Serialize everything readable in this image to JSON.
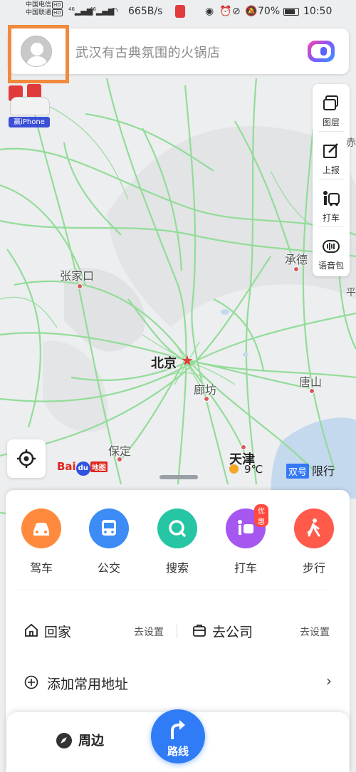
{
  "status_bar": {
    "carrier1": "中国电信",
    "carrier2": "中国联通",
    "hd": "HD",
    "net1": "46",
    "net2": "46",
    "speed": "665B/s",
    "battery": "70%",
    "time": "10:50"
  },
  "search": {
    "placeholder": "武汉有古典氛围的火锅店"
  },
  "promo": {
    "label": "赢iPhone"
  },
  "toolbar": {
    "layers": "图层",
    "report": "上报",
    "taxi": "打车",
    "voice_pack": "语音包"
  },
  "map": {
    "cities": {
      "zhangjiakou": "张家口",
      "chengde": "承德",
      "beijing": "北京",
      "langfang": "廊坊",
      "tangshan": "唐山",
      "baoding": "保定",
      "tianjin": "天津",
      "chi": "赤",
      "ping": "平"
    },
    "logo_bai": "Bai",
    "logo_du": "du",
    "logo_map": "地图",
    "weather": "9℃",
    "limit_tag": "双号",
    "limit_text": "限行"
  },
  "quick_actions": [
    {
      "label": "驾车",
      "color": "#ff8a3d"
    },
    {
      "label": "公交",
      "color": "#3d8bf5"
    },
    {
      "label": "搜索",
      "color": "#26c6a4"
    },
    {
      "label": "打车",
      "color": "#a557f0",
      "badge": "优惠"
    },
    {
      "label": "步行",
      "color": "#ff5a4a"
    }
  ],
  "places": {
    "home_label": "回家",
    "home_action": "去设置",
    "work_label": "去公司",
    "work_action": "去设置",
    "add_address": "添加常用地址"
  },
  "tabbar": {
    "nearby": "周边",
    "route": "路线"
  }
}
